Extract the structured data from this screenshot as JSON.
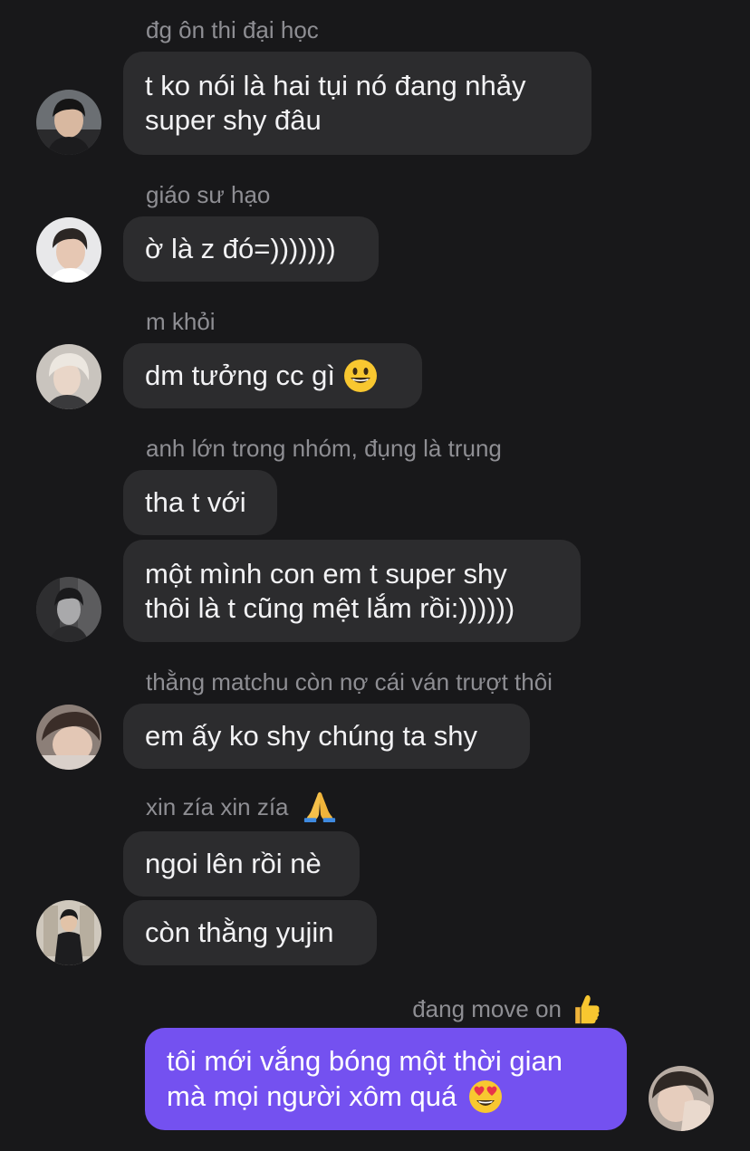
{
  "messages": [
    {
      "sender": "đg ôn thi đại học",
      "bubbles": [
        {
          "lines": [
            "t ko nói là hai tụi nó đang nhảy",
            "super shy đâu"
          ]
        }
      ]
    },
    {
      "sender": "giáo sư hạo",
      "bubbles": [
        {
          "text": "ờ là z đó=)))))))"
        }
      ]
    },
    {
      "sender": "m khỏi",
      "bubbles": [
        {
          "text": "dm tưởng cc gì",
          "emoji": "grinning-face-emoji"
        }
      ]
    },
    {
      "sender": "anh lớn trong nhóm, đụng là trụng",
      "bubbles": [
        {
          "text": "tha t với"
        },
        {
          "lines": [
            "một mình con em t super shy",
            "thôi là t cũng mệt lắm rồi:))))))"
          ]
        }
      ]
    },
    {
      "sender": "thằng matchu còn nợ cái ván trượt thôi",
      "bubbles": [
        {
          "text": "em ấy ko shy chúng ta shy"
        }
      ]
    },
    {
      "sender": "xin zía xin zía",
      "sender_emoji": "folded-hands-emoji",
      "bubbles": [
        {
          "text": "ngoi lên rồi nè"
        },
        {
          "text": "còn thằng yujin"
        }
      ]
    },
    {
      "sender": "đang move on",
      "sender_emoji": "thumbs-up-emoji",
      "mine": true,
      "bubbles": [
        {
          "lines": [
            "tôi mới vắng bóng một thời gian",
            "mà mọi người xôm quá"
          ],
          "emoji": "heart-eyes-emoji"
        }
      ]
    }
  ],
  "colors": {
    "background": "#18181a",
    "incoming_bubble": "#2c2c2e",
    "outgoing_bubble": "#7451f0",
    "sender_text": "#8e8e93",
    "message_text": "#f2f2f4"
  }
}
